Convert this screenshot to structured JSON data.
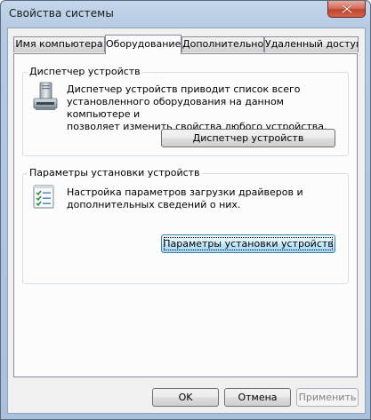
{
  "window": {
    "title": "Свойства системы"
  },
  "tabs": [
    {
      "label": "Имя компьютера"
    },
    {
      "label": "Оборудование"
    },
    {
      "label": "Дополнительно"
    },
    {
      "label": "Удаленный доступ"
    }
  ],
  "device_manager": {
    "title": "Диспетчер устройств",
    "description_lines": [
      "Диспетчер устройств приводит список всего",
      "установленного оборудования на данном компьютере и",
      "позволяет изменить свойства любого устройства."
    ],
    "button_label": "Диспетчер устройств",
    "icon": "device-manager-icon"
  },
  "device_installation": {
    "title": "Параметры установки устройств",
    "description_lines": [
      "Настройка параметров загрузки драйверов и",
      "дополнительных сведений о них."
    ],
    "button_label": "Параметры установки устройств",
    "icon": "checklist-icon"
  },
  "footer": {
    "ok_label": "OK",
    "cancel_label": "Отмена",
    "apply_label": "Применить"
  },
  "colors": {
    "window_frame": "#b5cbe3",
    "panel_background": "#fcfcfc",
    "close_button": "#c0442c",
    "focus_border": "#3c7fb1"
  }
}
